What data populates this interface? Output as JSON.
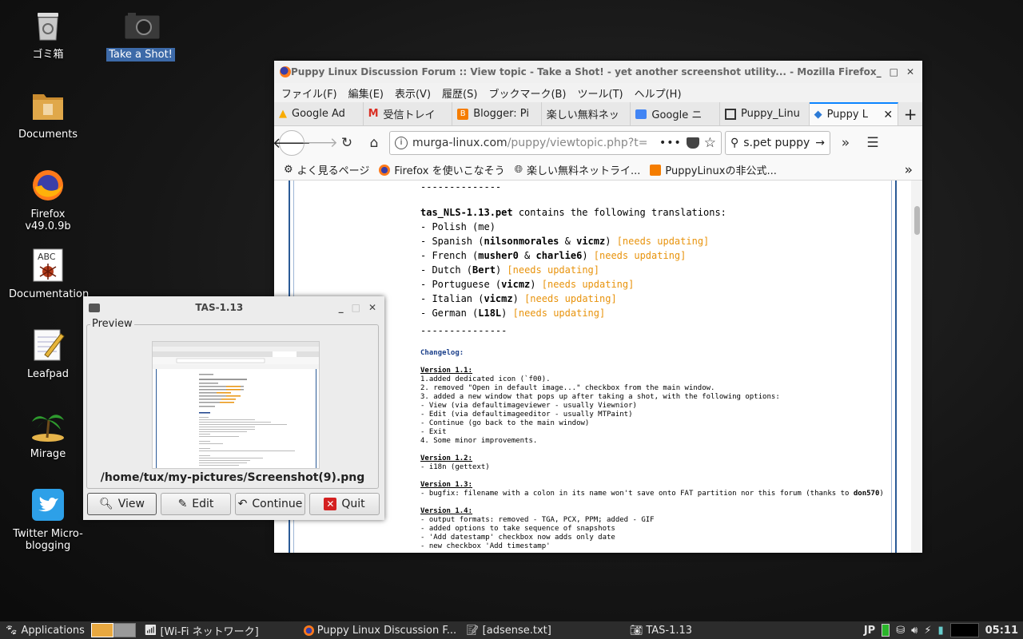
{
  "desktop": {
    "icons": [
      {
        "label": "ゴミ箱",
        "icon": "trash-icon"
      },
      {
        "label": "Take a Shot!",
        "icon": "camera-icon"
      },
      {
        "label": "Documents",
        "icon": "folder-icon"
      },
      {
        "label": "Firefox\nv49.0.9b",
        "label1": "Firefox",
        "label2": "v49.0.9b",
        "icon": "firefox-icon"
      },
      {
        "label": "Documentation",
        "icon": "documentation-icon"
      },
      {
        "label": "Leafpad",
        "icon": "leafpad-icon"
      },
      {
        "label": "Mirage",
        "icon": "mirage-icon"
      },
      {
        "label1": "Twitter Micro-",
        "label2": "blogging",
        "icon": "twitter-icon"
      }
    ]
  },
  "firefox": {
    "title": "Puppy Linux Discussion Forum :: View topic - Take a Shot! - yet another screenshot utility... - Mozilla Firefox",
    "menu": [
      "ファイル(F)",
      "編集(E)",
      "表示(V)",
      "履歴(S)",
      "ブックマーク(B)",
      "ツール(T)",
      "ヘルプ(H)"
    ],
    "tabs": [
      "Google Ad",
      "受信トレイ",
      "Blogger: Pi",
      "楽しい無料ネッ",
      "Google ニ",
      "Puppy_Linu",
      "Puppy L"
    ],
    "url_host": "murga-linux.com",
    "url_path": "/puppy/viewtopic.php?t=",
    "search_value": "s.pet puppy",
    "bookmarks": [
      "よく見るページ",
      "Firefox を使いこなそう",
      "楽しい無料ネットライ...",
      "PuppyLinuxの非公式..."
    ],
    "post": {
      "sep1": "--------------",
      "nls_name": "tas_NLS-1.13.pet",
      "nls_rest": " contains the following translations:",
      "needs": "[needs updating]",
      "polish": "- Polish (me)",
      "spanish_pre": "- Spanish (",
      "spanish_a": "nilsonmorales",
      "spanish_mid": " & ",
      "spanish_b": "vicmz",
      "french_pre": "- French (",
      "french_a": "musher0",
      "french_b": "charlie6",
      "dutch_pre": "- Dutch (",
      "dutch_a": "Bert",
      "portuguese_pre": "- Portuguese (",
      "portuguese_a": "vicmz",
      "italian_pre": "- Italian (",
      "italian_a": "vicmz",
      "german_pre": "- German (",
      "german_a": "L18L",
      "close_paren": ")",
      "sep2": "---------------",
      "changelog": "Changelog:",
      "v11": "Version 1.1:",
      "v11_lines": [
        "1.added dedicated icon (`f00).",
        "2. removed \"Open in default image...\" checkbox from the main window.",
        "3. added a new window that pops up after taking a shot, with the following options:",
        "- View (via defaultimageviewer - usually Viewnior)",
        "- Edit (via defaultimageeditor - usually MTPaint)",
        "- Continue (go back to the main window)",
        "- Exit",
        "4. Some minor improvements."
      ],
      "v12": "Version 1.2:",
      "v12_lines": [
        "- i18n (gettext)"
      ],
      "v13": "Version 1.3:",
      "v13_line_pre": "- bugfix: filename with a colon in its name won't save onto FAT partition nor this forum (thanks to ",
      "v13_line_user": "don570",
      "v13_line_post": ")",
      "v14": "Version 1.4:",
      "v14_lines": [
        "- output formats: removed - TGA, PCX, PPM; added - GIF",
        "- added options to take sequence of snapshots",
        "- 'Add datestamp' checkbox now adds only date",
        "- new checkbox 'Add timestamp'"
      ]
    }
  },
  "tas": {
    "title": "TAS-1.13",
    "preview_label": "Preview",
    "path": "/home/tux/my-pictures/Screenshot(9).png",
    "buttons": [
      "View",
      "Edit",
      "Continue",
      "Quit"
    ]
  },
  "taskbar": {
    "applications": "Applications",
    "items": [
      "[Wi-Fi ネットワーク]",
      "Puppy Linux Discussion F...",
      "[adsense.txt]",
      "TAS-1.13"
    ],
    "lang": "JP",
    "clock": "05:11"
  }
}
